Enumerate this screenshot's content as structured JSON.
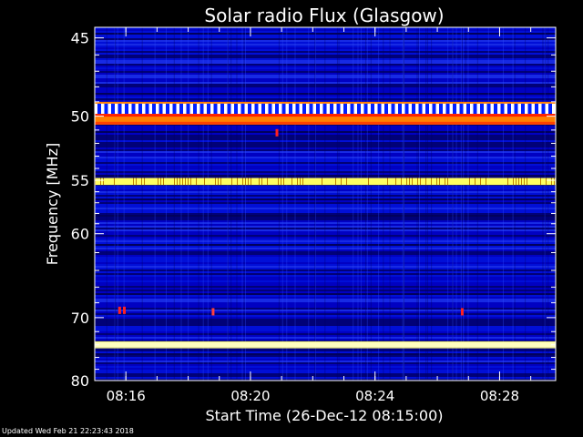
{
  "chart_data": {
    "type": "heatmap",
    "title": "Solar radio Flux (Glasgow)",
    "xlabel": "Start Time (26-Dec-12 08:15:00)",
    "ylabel": "Frequency [MHz]",
    "x_unit": "minutes after 08:15:00",
    "xlim": [
      0,
      14.8
    ],
    "ylim": [
      80.0,
      44.4
    ],
    "y_scale": "reciprocal",
    "x_ticks": [
      {
        "value": 1,
        "label": "08:16"
      },
      {
        "value": 5,
        "label": "08:20"
      },
      {
        "value": 9,
        "label": "08:24"
      },
      {
        "value": 13,
        "label": "08:28"
      }
    ],
    "y_ticks": [
      {
        "value": 45,
        "label": "45"
      },
      {
        "value": 50,
        "label": "50"
      },
      {
        "value": 55,
        "label": "55"
      },
      {
        "value": 60,
        "label": "60"
      },
      {
        "value": 70,
        "label": "70"
      },
      {
        "value": 80,
        "label": "80"
      }
    ],
    "colormap": [
      "#000060",
      "#0000ff",
      "#3060ff",
      "#ff3000",
      "#ffff60",
      "#ffffe0"
    ],
    "background_level": "low (dark blue)",
    "bands": [
      {
        "f_low": 49.0,
        "f_high": 50.6,
        "level": "high",
        "color": "#ff8000",
        "pattern": "pulsed"
      },
      {
        "f_low": 54.8,
        "f_high": 55.4,
        "level": "high",
        "color": "#ffff60"
      },
      {
        "f_low": 73.6,
        "f_high": 74.4,
        "level": "saturated",
        "color": "#ffffc0"
      }
    ],
    "spots": [
      {
        "t": 0.8,
        "f": 69.0,
        "color": "#ff2020"
      },
      {
        "t": 0.95,
        "f": 69.0,
        "color": "#ff2020"
      },
      {
        "t": 5.85,
        "f": 51.2,
        "color": "#ff2020"
      },
      {
        "t": 11.8,
        "f": 69.2,
        "color": "#ff2020"
      },
      {
        "t": 3.8,
        "f": 69.2,
        "color": "#ff4040"
      }
    ]
  },
  "footer": {
    "updated": "Updated Wed Feb 21 22:23:43 2018"
  }
}
